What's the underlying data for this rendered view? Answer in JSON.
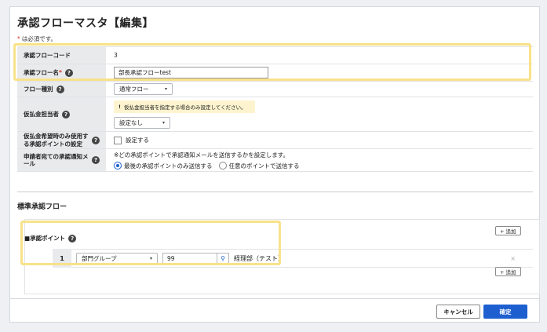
{
  "page": {
    "title": "承認フローマスタ【編集】",
    "required_note": "は必須です。",
    "required_mark": "*"
  },
  "form": {
    "code": {
      "label": "承認フローコード",
      "value": "3"
    },
    "name": {
      "label": "承認フロー名",
      "required": "*",
      "value": "部長承認フローtest"
    },
    "type": {
      "label": "フロー種別",
      "value": "通常フロー"
    },
    "assignee": {
      "label": "仮払金担当者",
      "alert": "仮払金担当者を指定する場合のみ設定してください。",
      "alert_mark": "!",
      "value": "設定なし"
    },
    "desired_point": {
      "label": "仮払金希望時のみ使用する承認ポイントの設定",
      "checkbox_label": "設定する"
    },
    "notify": {
      "label": "申請者宛ての承認通知メール",
      "description": "※どの承認ポイントで承認通知メールを送信するかを設定します。",
      "option_last": "最後の承認ポイントのみ送信する",
      "option_any": "任意のポイントで送信する"
    }
  },
  "standard_flow": {
    "title": "標準承認フロー",
    "approval_point": {
      "label": "■承認ポイント",
      "add_label": "+ 追加",
      "rows": [
        {
          "index": "1",
          "group": "部門グループ",
          "code": "99",
          "result": "経理部（テスト）"
        }
      ],
      "row_delete": "×"
    }
  },
  "footer": {
    "cancel": "キャンセル",
    "confirm": "確定"
  },
  "icons": {
    "help": "?",
    "search": "⚲",
    "caret": "▾"
  },
  "colors": {
    "primary": "#1e5fd0",
    "highlight": "#f8e28a",
    "required": "#d9352b",
    "alert_bg": "#fdf4cf"
  }
}
